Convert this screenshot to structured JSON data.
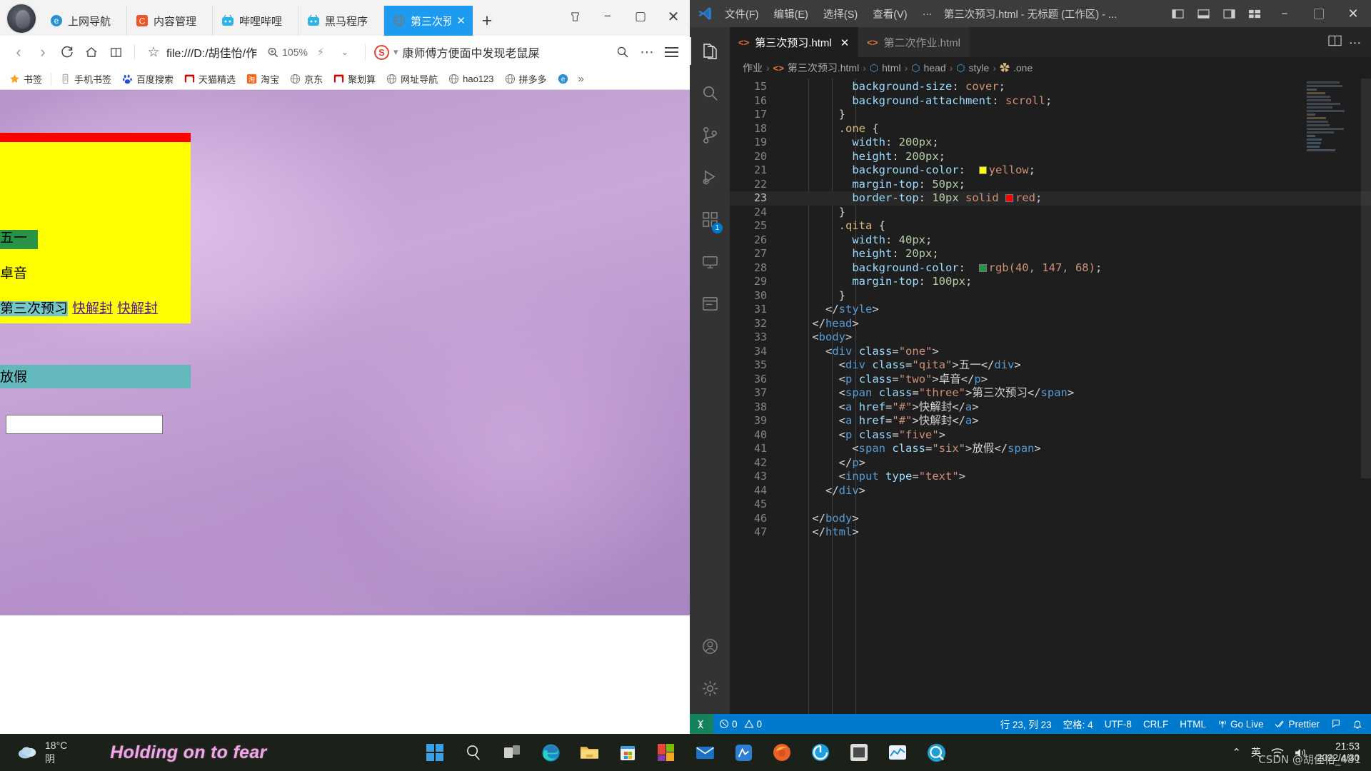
{
  "browser": {
    "tabs": [
      {
        "label": "上网导航",
        "icon": "ie-icon",
        "active": false
      },
      {
        "label": "内容管理",
        "icon": "cms-icon",
        "active": false
      },
      {
        "label": "哔哩哔哩",
        "icon": "bilibili-icon",
        "active": false
      },
      {
        "label": "黑马程序",
        "icon": "bilibili-icon",
        "active": false
      },
      {
        "label": "第三次预",
        "icon": "globe-icon",
        "active": true
      }
    ],
    "new_tab_label": "+",
    "window_controls": {
      "layout": "⊓",
      "minimize": "−",
      "maximize": "▢",
      "close": "✕"
    },
    "toolbar": {
      "back": "‹",
      "forward": "›",
      "reload": "⟳",
      "home": "⌂",
      "reader": "▯▯",
      "star": "☆",
      "url": "file:///D:/胡佳怡/作",
      "zoom_level": "105%",
      "bolt": "⚡",
      "caret": "⌄",
      "search_engine": "S",
      "search_text": "康师傅方便面中发现老鼠屎",
      "search_icon": "search-icon",
      "more": "⋯",
      "menu": "≡"
    },
    "bookmarks": [
      {
        "label": "书签",
        "icon": "star-icon"
      },
      {
        "label": "手机书签",
        "icon": "phone-icon"
      },
      {
        "label": "百度搜索",
        "icon": "baidu-icon"
      },
      {
        "label": "天猫精选",
        "icon": "tmall-icon"
      },
      {
        "label": "淘宝",
        "icon": "taobao-icon"
      },
      {
        "label": "京东",
        "icon": "globe-icon"
      },
      {
        "label": "聚划算",
        "icon": "tmall-icon"
      },
      {
        "label": "网址导航",
        "icon": "globe-icon"
      },
      {
        "label": "hao123",
        "icon": "globe-icon"
      },
      {
        "label": "拼多多",
        "icon": "globe-icon"
      },
      {
        "label": "",
        "icon": "ie-icon"
      }
    ],
    "bookmarks_overflow": "»"
  },
  "webpage": {
    "qita_text": "五一",
    "two_text": "卓音",
    "three_text": "第三次预习",
    "link1_text": "快解封",
    "link2_text": "快解封",
    "six_text": "放假",
    "input_value": "",
    "colors": {
      "one_bg": "#ffff00",
      "one_border_top": "#ff0000",
      "qita_bg": "rgb(40, 147, 68)",
      "three_bg": "#74c6c9",
      "five_bg": "#63b8bd",
      "link": "#551a8b"
    }
  },
  "vscode": {
    "menus": [
      "文件(F)",
      "编辑(E)",
      "选择(S)",
      "查看(V)",
      "…"
    ],
    "window_title": "第三次预习.html - 无标题 (工作区) - ...",
    "window_controls": {
      "minimize": "−",
      "maximize": "▢",
      "close": "✕"
    },
    "layout_icons": [
      "panel-left-icon",
      "panel-bottom-icon",
      "panel-right-icon",
      "layout-grid-icon"
    ],
    "activity_bar": [
      {
        "name": "explorer",
        "icon": "files-icon",
        "badge": ""
      },
      {
        "name": "search",
        "icon": "search-icon",
        "badge": ""
      },
      {
        "name": "source-control",
        "icon": "source-control-icon",
        "badge": ""
      },
      {
        "name": "run-debug",
        "icon": "run-debug-icon",
        "badge": ""
      },
      {
        "name": "extensions",
        "icon": "extensions-icon",
        "badge": "1"
      },
      {
        "name": "remote",
        "icon": "remote-explorer-icon",
        "badge": ""
      },
      {
        "name": "live-server",
        "icon": "live-server-icon",
        "badge": ""
      },
      {
        "name": "accounts",
        "icon": "account-icon",
        "badge": ""
      },
      {
        "name": "settings",
        "icon": "gear-icon",
        "badge": ""
      }
    ],
    "tabs": [
      {
        "label": "第三次预习.html",
        "active": true,
        "close": "✕"
      },
      {
        "label": "第二次作业.html",
        "active": false,
        "close": ""
      }
    ],
    "tabs_right": [
      "split-editor-icon",
      "more-actions-icon"
    ],
    "breadcrumbs": [
      "作业",
      "第三次预习.html",
      "html",
      "head",
      "style",
      ".one"
    ],
    "status_bar": {
      "remote_icon": "remote-icon",
      "errors": "0",
      "warnings": "0",
      "cursor": "行 23, 列 23",
      "indent": "空格: 4",
      "encoding": "UTF-8",
      "eol": "CRLF",
      "language": "HTML",
      "go_live": "Go Live",
      "prettier": "Prettier",
      "feedback_icon": "feedback-icon",
      "bell_icon": "bell-icon"
    },
    "code_lines": [
      {
        "n": 15,
        "indent": 5,
        "tokens": [
          [
            "prop",
            "background-size"
          ],
          [
            "punc",
            ": "
          ],
          [
            "val",
            "cover"
          ],
          [
            "punc",
            ";"
          ]
        ]
      },
      {
        "n": 16,
        "indent": 5,
        "tokens": [
          [
            "prop",
            "background-attachment"
          ],
          [
            "punc",
            ": "
          ],
          [
            "val",
            "scroll"
          ],
          [
            "punc",
            ";"
          ]
        ]
      },
      {
        "n": 17,
        "indent": 4,
        "tokens": [
          [
            "punc",
            "}"
          ]
        ]
      },
      {
        "n": 18,
        "indent": 4,
        "tokens": [
          [
            "sel",
            ".one"
          ],
          [
            "punc",
            " {"
          ]
        ]
      },
      {
        "n": 19,
        "indent": 5,
        "tokens": [
          [
            "prop",
            "width"
          ],
          [
            "punc",
            ": "
          ],
          [
            "num",
            "200px"
          ],
          [
            "punc",
            ";"
          ]
        ]
      },
      {
        "n": 20,
        "indent": 5,
        "tokens": [
          [
            "prop",
            "height"
          ],
          [
            "punc",
            ": "
          ],
          [
            "num",
            "200px"
          ],
          [
            "punc",
            ";"
          ]
        ]
      },
      {
        "n": 21,
        "indent": 5,
        "tokens": [
          [
            "prop",
            "background-color"
          ],
          [
            "punc",
            ":  "
          ],
          [
            "swatch",
            "#ffff00"
          ],
          [
            "val",
            "yellow"
          ],
          [
            "punc",
            ";"
          ]
        ]
      },
      {
        "n": 22,
        "indent": 5,
        "tokens": [
          [
            "prop",
            "margin-top"
          ],
          [
            "punc",
            ": "
          ],
          [
            "num",
            "50px"
          ],
          [
            "punc",
            ";"
          ]
        ]
      },
      {
        "n": 23,
        "indent": 5,
        "current": true,
        "tokens": [
          [
            "prop",
            "border-top"
          ],
          [
            "punc",
            ": "
          ],
          [
            "num",
            "10px"
          ],
          [
            "punc",
            " "
          ],
          [
            "val",
            "solid"
          ],
          [
            "punc",
            " "
          ],
          [
            "swatch",
            "#ff0000"
          ],
          [
            "val",
            "red"
          ],
          [
            "punc",
            ";"
          ]
        ]
      },
      {
        "n": 24,
        "indent": 4,
        "tokens": [
          [
            "punc",
            "}"
          ]
        ]
      },
      {
        "n": 25,
        "indent": 4,
        "tokens": [
          [
            "sel",
            ".qita"
          ],
          [
            "punc",
            " {"
          ]
        ]
      },
      {
        "n": 26,
        "indent": 5,
        "tokens": [
          [
            "prop",
            "width"
          ],
          [
            "punc",
            ": "
          ],
          [
            "num",
            "40px"
          ],
          [
            "punc",
            ";"
          ]
        ]
      },
      {
        "n": 27,
        "indent": 5,
        "tokens": [
          [
            "prop",
            "height"
          ],
          [
            "punc",
            ": "
          ],
          [
            "num",
            "20px"
          ],
          [
            "punc",
            ";"
          ]
        ]
      },
      {
        "n": 28,
        "indent": 5,
        "tokens": [
          [
            "prop",
            "background-color"
          ],
          [
            "punc",
            ":  "
          ],
          [
            "swatch",
            "#289344"
          ],
          [
            "val",
            "rgb(40, 147, 68)"
          ],
          [
            "punc",
            ";"
          ]
        ]
      },
      {
        "n": 29,
        "indent": 5,
        "tokens": [
          [
            "prop",
            "margin-top"
          ],
          [
            "punc",
            ": "
          ],
          [
            "num",
            "100px"
          ],
          [
            "punc",
            ";"
          ]
        ]
      },
      {
        "n": 30,
        "indent": 4,
        "tokens": [
          [
            "punc",
            "}"
          ]
        ]
      },
      {
        "n": 31,
        "indent": 3,
        "tokens": [
          [
            "punc",
            "</"
          ],
          [
            "tag",
            "style"
          ],
          [
            "punc",
            ">"
          ]
        ]
      },
      {
        "n": 32,
        "indent": 2,
        "tokens": [
          [
            "punc",
            "</"
          ],
          [
            "tag",
            "head"
          ],
          [
            "punc",
            ">"
          ]
        ]
      },
      {
        "n": 33,
        "indent": 2,
        "tokens": [
          [
            "punc",
            "<"
          ],
          [
            "tag",
            "body"
          ],
          [
            "punc",
            ">"
          ]
        ]
      },
      {
        "n": 34,
        "indent": 3,
        "tokens": [
          [
            "punc",
            "<"
          ],
          [
            "tag",
            "div"
          ],
          [
            "punc",
            " "
          ],
          [
            "attr",
            "class"
          ],
          [
            "punc",
            "="
          ],
          [
            "str",
            "\"one\""
          ],
          [
            "punc",
            ">"
          ]
        ]
      },
      {
        "n": 35,
        "indent": 4,
        "tokens": [
          [
            "punc",
            "<"
          ],
          [
            "tag",
            "div"
          ],
          [
            "punc",
            " "
          ],
          [
            "attr",
            "class"
          ],
          [
            "punc",
            "="
          ],
          [
            "str",
            "\"qita\""
          ],
          [
            "punc",
            ">"
          ],
          [
            "text",
            "五一"
          ],
          [
            "punc",
            "</"
          ],
          [
            "tag",
            "div"
          ],
          [
            "punc",
            ">"
          ]
        ]
      },
      {
        "n": 36,
        "indent": 4,
        "tokens": [
          [
            "punc",
            "<"
          ],
          [
            "tag",
            "p"
          ],
          [
            "punc",
            " "
          ],
          [
            "attr",
            "class"
          ],
          [
            "punc",
            "="
          ],
          [
            "str",
            "\"two\""
          ],
          [
            "punc",
            ">"
          ],
          [
            "text",
            "卓音"
          ],
          [
            "punc",
            "</"
          ],
          [
            "tag",
            "p"
          ],
          [
            "punc",
            ">"
          ]
        ]
      },
      {
        "n": 37,
        "indent": 4,
        "tokens": [
          [
            "punc",
            "<"
          ],
          [
            "tag",
            "span"
          ],
          [
            "punc",
            " "
          ],
          [
            "attr",
            "class"
          ],
          [
            "punc",
            "="
          ],
          [
            "str",
            "\"three\""
          ],
          [
            "punc",
            ">"
          ],
          [
            "text",
            "第三次预习"
          ],
          [
            "punc",
            "</"
          ],
          [
            "tag",
            "span"
          ],
          [
            "punc",
            ">"
          ]
        ]
      },
      {
        "n": 38,
        "indent": 4,
        "tokens": [
          [
            "punc",
            "<"
          ],
          [
            "tag",
            "a"
          ],
          [
            "punc",
            " "
          ],
          [
            "attr",
            "href"
          ],
          [
            "punc",
            "="
          ],
          [
            "str",
            "\"#\""
          ],
          [
            "punc",
            ">"
          ],
          [
            "text",
            "快解封"
          ],
          [
            "punc",
            "</"
          ],
          [
            "tag",
            "a"
          ],
          [
            "punc",
            ">"
          ]
        ]
      },
      {
        "n": 39,
        "indent": 4,
        "tokens": [
          [
            "punc",
            "<"
          ],
          [
            "tag",
            "a"
          ],
          [
            "punc",
            " "
          ],
          [
            "attr",
            "href"
          ],
          [
            "punc",
            "="
          ],
          [
            "str",
            "\"#\""
          ],
          [
            "punc",
            ">"
          ],
          [
            "text",
            "快解封"
          ],
          [
            "punc",
            "</"
          ],
          [
            "tag",
            "a"
          ],
          [
            "punc",
            ">"
          ]
        ]
      },
      {
        "n": 40,
        "indent": 4,
        "tokens": [
          [
            "punc",
            "<"
          ],
          [
            "tag",
            "p"
          ],
          [
            "punc",
            " "
          ],
          [
            "attr",
            "class"
          ],
          [
            "punc",
            "="
          ],
          [
            "str",
            "\"five\""
          ],
          [
            "punc",
            ">"
          ]
        ]
      },
      {
        "n": 41,
        "indent": 5,
        "tokens": [
          [
            "punc",
            "<"
          ],
          [
            "tag",
            "span"
          ],
          [
            "punc",
            " "
          ],
          [
            "attr",
            "class"
          ],
          [
            "punc",
            "="
          ],
          [
            "str",
            "\"six\""
          ],
          [
            "punc",
            ">"
          ],
          [
            "text",
            "放假"
          ],
          [
            "punc",
            "</"
          ],
          [
            "tag",
            "span"
          ],
          [
            "punc",
            ">"
          ]
        ]
      },
      {
        "n": 42,
        "indent": 4,
        "tokens": [
          [
            "punc",
            "</"
          ],
          [
            "tag",
            "p"
          ],
          [
            "punc",
            ">"
          ]
        ]
      },
      {
        "n": 43,
        "indent": 4,
        "tokens": [
          [
            "punc",
            "<"
          ],
          [
            "tag",
            "input"
          ],
          [
            "punc",
            " "
          ],
          [
            "attr",
            "type"
          ],
          [
            "punc",
            "="
          ],
          [
            "str",
            "\"text\""
          ],
          [
            "punc",
            ">"
          ]
        ]
      },
      {
        "n": 44,
        "indent": 3,
        "tokens": [
          [
            "punc",
            "</"
          ],
          [
            "tag",
            "div"
          ],
          [
            "punc",
            ">"
          ]
        ]
      },
      {
        "n": 45,
        "indent": 0,
        "tokens": []
      },
      {
        "n": 46,
        "indent": 2,
        "tokens": [
          [
            "punc",
            "</"
          ],
          [
            "tag",
            "body"
          ],
          [
            "punc",
            ">"
          ]
        ]
      },
      {
        "n": 47,
        "indent": 2,
        "tokens": [
          [
            "punc",
            "</"
          ],
          [
            "tag",
            "html"
          ],
          [
            "punc",
            ">"
          ]
        ]
      }
    ]
  },
  "taskbar": {
    "weather_temp": "18°C",
    "weather_desc": "阴",
    "song_title": "Holding on to fear",
    "apps": [
      {
        "name": "start",
        "icon": "windows-start-icon"
      },
      {
        "name": "search",
        "icon": "search-icon"
      },
      {
        "name": "task-view",
        "icon": "task-view-icon"
      },
      {
        "name": "edge",
        "icon": "edge-icon"
      },
      {
        "name": "file-explorer",
        "icon": "folder-icon"
      },
      {
        "name": "microsoft-store",
        "icon": "store-icon"
      },
      {
        "name": "office",
        "icon": "office-icon"
      },
      {
        "name": "mail",
        "icon": "mail-icon"
      },
      {
        "name": "xmind",
        "icon": "xmind-icon"
      },
      {
        "name": "firefox",
        "icon": "firefox-icon"
      },
      {
        "name": "kugou",
        "icon": "kugou-icon"
      },
      {
        "name": "vscode-taskbar",
        "icon": "vscode-icon"
      },
      {
        "name": "visual-studio",
        "icon": "chart-icon"
      },
      {
        "name": "sogou-browser",
        "icon": "sogou-icon"
      }
    ],
    "tray": {
      "chevron": "⌃",
      "ime": "英",
      "wifi_icon": "wifi-icon",
      "volume_icon": "volume-icon",
      "time": "21:53",
      "date": "2022/4/30"
    },
    "watermark": "CSDN @胡佳怡_481"
  }
}
